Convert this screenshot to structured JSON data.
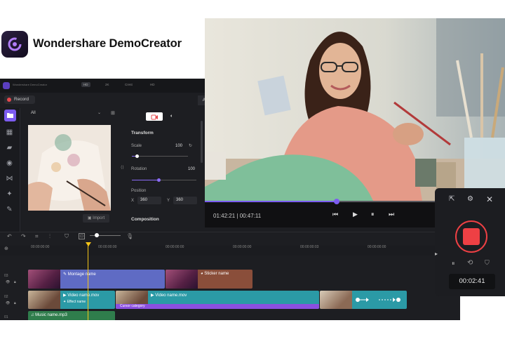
{
  "brand": {
    "name": "Wondershare DemoCreator"
  },
  "editor": {
    "titlebar": {
      "app_title": "Wondershare DemoCreator",
      "resolution_tabs": [
        "HD",
        "2K",
        "Crest",
        "HD"
      ]
    },
    "record_label": "Record",
    "side_tab_label": "Adv",
    "media": {
      "filter": "All",
      "import_label": "Import"
    },
    "properties": {
      "transform_header": "Transform",
      "scale_label": "Scale",
      "scale_value": "100",
      "rotation_label": "Rotation",
      "rotation_value": "100",
      "position_label": "Position",
      "x_label": "X",
      "x_value": "360",
      "y_label": "Y",
      "y_value": "360",
      "composition_header": "Composition"
    }
  },
  "timeline": {
    "ruler_ticks": [
      "00:00:00:00",
      "00:00:00:00",
      "00:00:00:00",
      "00:00:00:00",
      "00:00:00:03",
      "00:00:00:00"
    ],
    "tracks": [
      {
        "number": "03"
      },
      {
        "number": "02"
      },
      {
        "number": "01"
      }
    ],
    "clips": {
      "montage": "Montage name",
      "sticker": "Sticker name",
      "video1": "Video name.mov",
      "effect": "Effect name",
      "video2": "Video name.mov",
      "cursor": "Cursor category",
      "music": "Music name.mp3"
    }
  },
  "player": {
    "current_time": "01:42:21",
    "separator": "|",
    "total_time": "00:47:11",
    "progress": 0.44
  },
  "recorder": {
    "timer": "00:02:41"
  },
  "colors": {
    "accent": "#7c5cf0",
    "record_red": "#ee4044",
    "playhead": "#f5c518"
  }
}
